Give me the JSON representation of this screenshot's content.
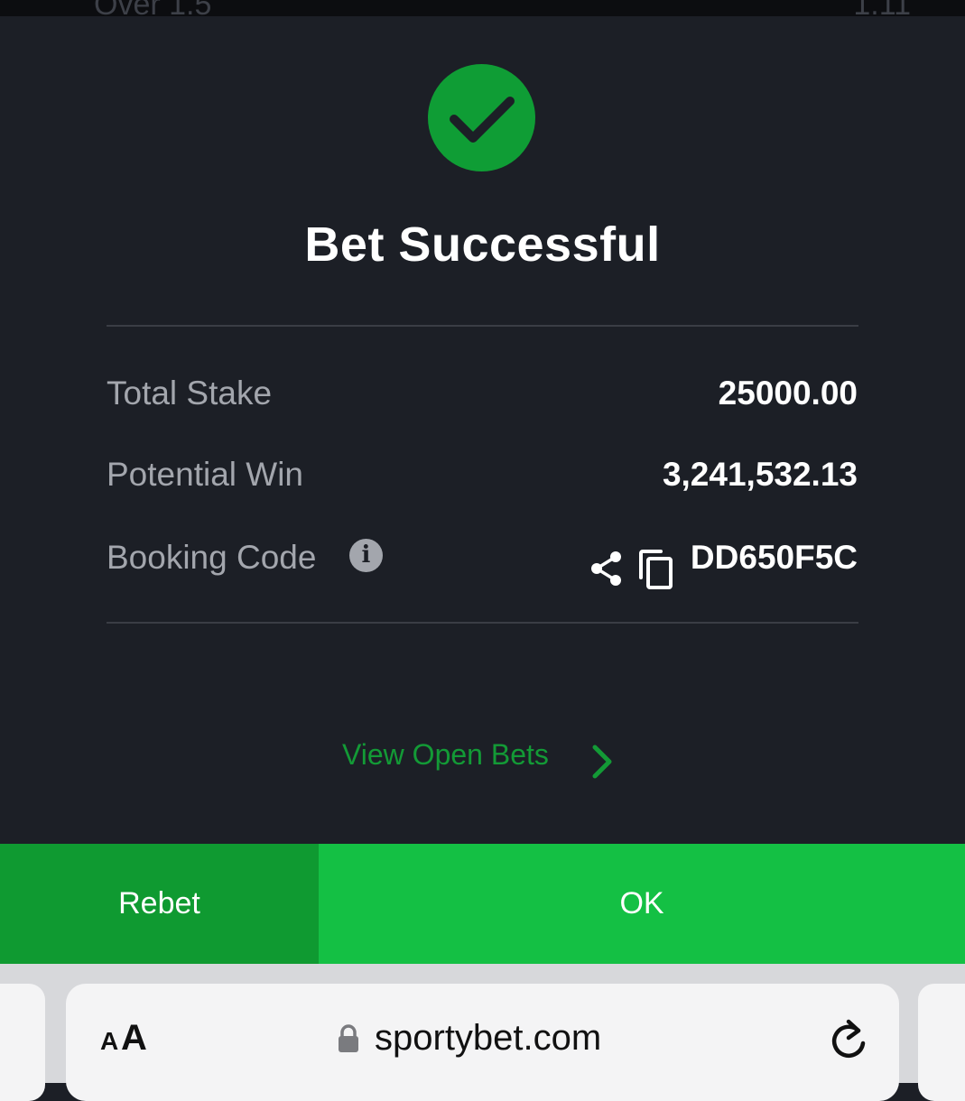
{
  "status_strip": {
    "left_text": "Over 1.5",
    "right_text": "1.11"
  },
  "dialog": {
    "title": "Bet Successful",
    "total_stake_label": "Total Stake",
    "total_stake_value": "25000.00",
    "potential_win_label": "Potential Win",
    "potential_win_value": "3,241,532.13",
    "booking_code_label": "Booking Code",
    "booking_code_value": "DD650F5C",
    "view_open_bets": "View Open Bets"
  },
  "actions": {
    "rebet_label": "Rebet",
    "ok_label": "OK"
  },
  "browser": {
    "text_size_small": "A",
    "text_size_large": "A",
    "url": "sportybet.com"
  },
  "icons": {
    "success": "check-icon",
    "info": "info-icon",
    "share": "share-icon",
    "copy": "copy-icon",
    "chevron": "chevron-right-icon",
    "lock": "lock-icon",
    "reload": "reload-icon"
  },
  "colors": {
    "background": "#1c1f26",
    "success_green": "#0f9d35",
    "rebet_green": "#0f9a31",
    "ok_green": "#14c044",
    "link_green": "#139a36",
    "label_gray": "#a3a6ad"
  }
}
